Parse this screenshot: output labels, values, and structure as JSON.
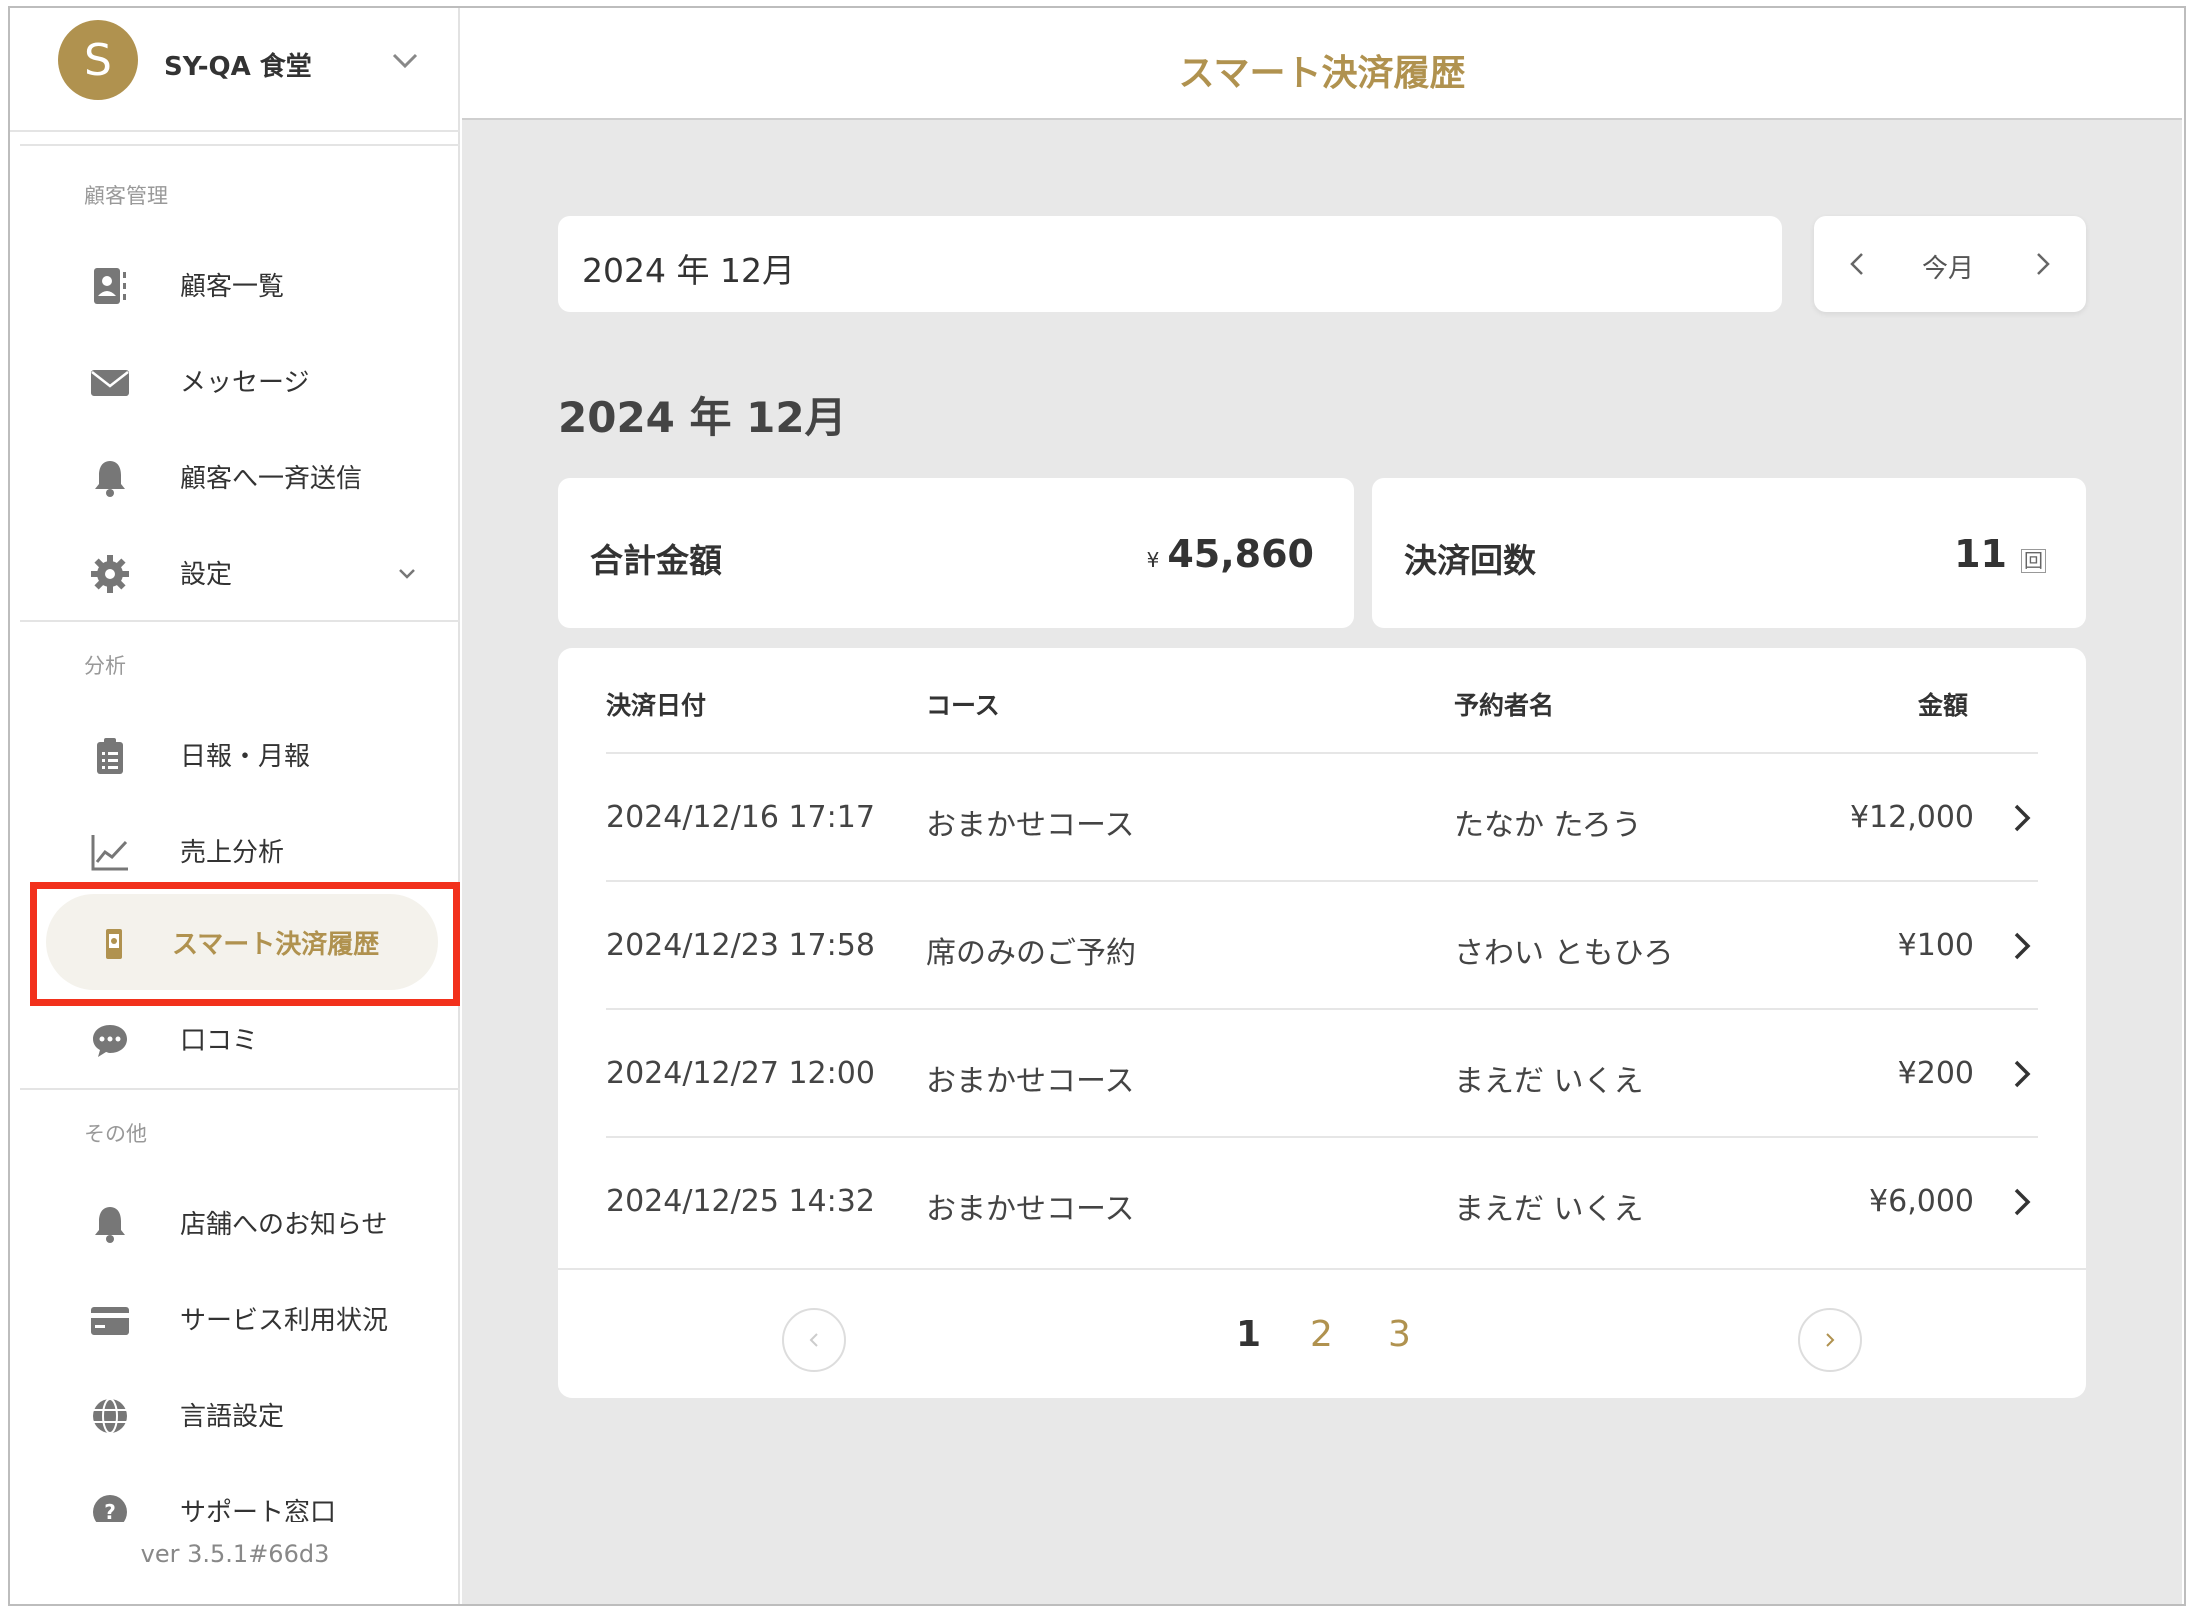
{
  "colors": {
    "accent": "#b0924f",
    "highlight": "#f2311c",
    "main_bg": "#e8e8e8"
  },
  "sidebar": {
    "shop": {
      "avatar_letter": "S",
      "name": "SY-QA 食堂",
      "chevron_icon": "chevron-down-icon"
    },
    "sections": {
      "customer": "顧客管理",
      "analysis": "分析",
      "other": "その他"
    },
    "items": [
      {
        "label": "顧客一覧",
        "icon": "contact-card-icon"
      },
      {
        "label": "メッセージ",
        "icon": "envelope-icon"
      },
      {
        "label": "顧客へ一斉送信",
        "icon": "bell-icon"
      },
      {
        "label": "設定",
        "icon": "gear-icon"
      },
      {
        "label": "日報・月報",
        "icon": "clipboard-icon"
      },
      {
        "label": "売上分析",
        "icon": "line-chart-icon"
      },
      {
        "label": "スマート決済履歴",
        "icon": "phone-payment-icon",
        "active": true
      },
      {
        "label": "口コミ",
        "icon": "chat-bubble-icon"
      },
      {
        "label": "店舗へのお知らせ",
        "icon": "bell-icon"
      },
      {
        "label": "サービス利用状況",
        "icon": "credit-card-icon"
      },
      {
        "label": "言語設定",
        "icon": "globe-icon"
      },
      {
        "label": "サポート窓口",
        "icon": "help-circle-icon"
      }
    ],
    "version": "ver 3.5.1#66d3"
  },
  "header": {
    "title": "スマート決済履歴"
  },
  "month_picker": {
    "value": "2024 年 12月",
    "today_label": "今月"
  },
  "section_heading": "2024 年 12月",
  "stats": {
    "total": {
      "label": "合計金額",
      "currency": "¥",
      "value": "45,860"
    },
    "count": {
      "label": "決済回数",
      "value": "11",
      "unit": "回"
    }
  },
  "table": {
    "columns": {
      "date": "決済日付",
      "course": "コース",
      "name": "予約者名",
      "amount": "金額"
    },
    "rows": [
      {
        "date": "2024/12/16 17:17",
        "course": "おまかせコース",
        "name": "たなか たろう",
        "amount": "¥12,000"
      },
      {
        "date": "2024/12/23 17:58",
        "course": "席のみのご予約",
        "name": "さわい ともひろ",
        "amount": "¥100"
      },
      {
        "date": "2024/12/27 12:00",
        "course": "おまかせコース",
        "name": "まえだ いくえ",
        "amount": "¥200"
      },
      {
        "date": "2024/12/25 14:32",
        "course": "おまかせコース",
        "name": "まえだ いくえ",
        "amount": "¥6,000"
      }
    ]
  },
  "pagination": {
    "pages": [
      "1",
      "2",
      "3"
    ],
    "current": "1"
  }
}
